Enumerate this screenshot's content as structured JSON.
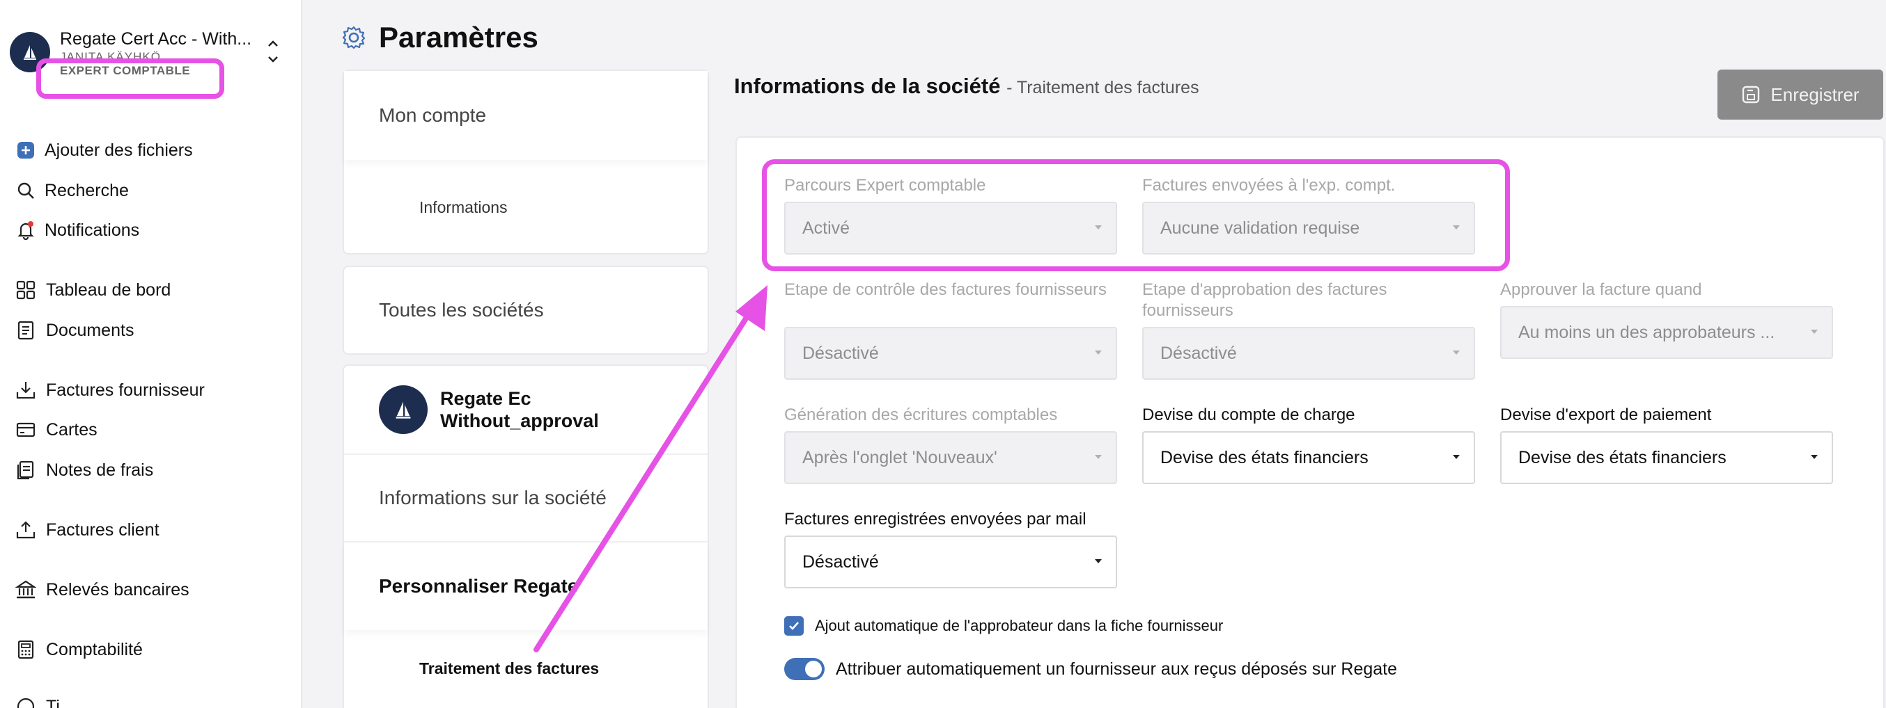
{
  "sidebar": {
    "org_name": "Regate Cert Acc - With...",
    "org_user": "JANITA KÄYHKÖ",
    "org_role": "EXPERT COMPTABLE",
    "items": [
      {
        "label": "Ajouter des fichiers",
        "icon": "plus-square-icon"
      },
      {
        "label": "Recherche",
        "icon": "search-icon"
      },
      {
        "label": "Notifications",
        "icon": "bell-icon"
      },
      {
        "label": "Tableau de bord",
        "icon": "grid-icon"
      },
      {
        "label": "Documents",
        "icon": "document-icon"
      },
      {
        "label": "Factures fournisseur",
        "icon": "download-tray-icon"
      },
      {
        "label": "Cartes",
        "icon": "card-icon"
      },
      {
        "label": "Notes de frais",
        "icon": "receipt-icon"
      },
      {
        "label": "Factures client",
        "icon": "upload-tray-icon"
      },
      {
        "label": "Relevés bancaires",
        "icon": "bank-icon"
      },
      {
        "label": "Comptabilité",
        "icon": "calculator-icon"
      },
      {
        "label": "Ti...",
        "icon": "more-icon"
      }
    ]
  },
  "header": {
    "title": "Paramètres",
    "icon": "gear-icon"
  },
  "menu": {
    "mon_compte": "Mon compte",
    "informations": "Informations",
    "toutes_societes": "Toutes les sociétés",
    "company_name": "Regate Ec Without_approval",
    "infos_societe": "Informations sur la société",
    "personnaliser": "Personnaliser Regate",
    "traitement": "Traitement des factures"
  },
  "content": {
    "section_title": "Informations de la société",
    "section_sub": "- Traitement des factures",
    "save_label": "Enregistrer",
    "fields": {
      "parcours_label": "Parcours Expert comptable",
      "parcours_value": "Activé",
      "envoyees_label": "Factures envoyées à l'exp. compt.",
      "envoyees_value": "Aucune validation requise",
      "controle_label": "Etape de contrôle des factures fournisseurs",
      "controle_value": "Désactivé",
      "approbation_label": "Etape d'approbation des factures fournisseurs",
      "approbation_value": "Désactivé",
      "approuver_label": "Approuver la facture quand",
      "approuver_value": "Au moins un des approbateurs ...",
      "generation_label": "Génération des écritures comptables",
      "generation_value": "Après l'onglet 'Nouveaux'",
      "devise_charge_label": "Devise du compte de charge",
      "devise_charge_value": "Devise des états financiers",
      "devise_paiement_label": "Devise d'export de paiement",
      "devise_paiement_value": "Devise des états financiers",
      "mail_label": "Factures enregistrées envoyées par mail",
      "mail_value": "Désactivé"
    },
    "checkbox_label": "Ajout automatique de l'approbateur dans la fiche fournisseur",
    "toggle_label": "Attribuer automatiquement un fournisseur aux reçus déposés sur Regate"
  },
  "colors": {
    "highlight": "#e652e6",
    "accent": "#3f6fb6",
    "avatar": "#1d2d4f",
    "save_button": "#8a8a8a"
  }
}
